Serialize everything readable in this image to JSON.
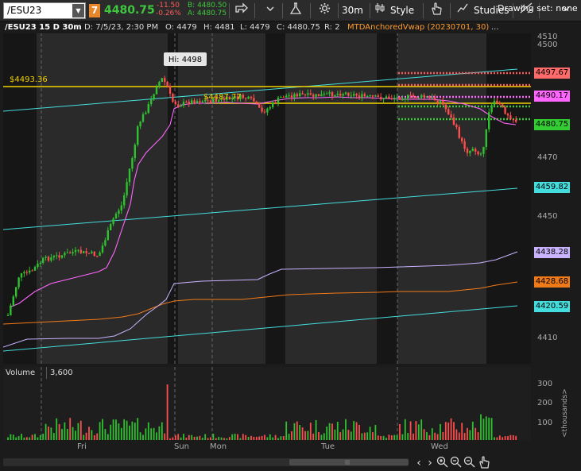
{
  "toolbar": {
    "symbol": "/ESU23",
    "badge": "7",
    "last_price": "4480.75",
    "change": "-11.50",
    "change_pct": "-0.26%",
    "bid": "B: 4480.50",
    "ask": "A: 4480.75",
    "timeframe": "30m",
    "style_label": "Style",
    "studies_label": "Studies"
  },
  "header": {
    "symbol_tf": "/ESU23 15 D 30m",
    "date": "D: 7/5/23, 2:30 PM",
    "open": "O: 4479",
    "high": "H: 4481",
    "low": "L: 4479",
    "close": "C: 4480.75",
    "range": "R: 2",
    "study": "MTDAnchoredVwap (20230701, 30)",
    "more": "..."
  },
  "annotations": {
    "hi_label": "Hi: 4498",
    "level_left": "$4493.36",
    "level_mid": "$4487.77"
  },
  "price_axis": {
    "ticks": [
      "4510",
      "4500",
      "4470",
      "4450",
      "4410"
    ],
    "tags": [
      {
        "label": "4497.67",
        "color": "#ff6a6a"
      },
      {
        "label": "4490.17",
        "color": "#ff66ff"
      },
      {
        "label": "4480.75",
        "color": "#33cc33"
      },
      {
        "label": "4459.82",
        "color": "#44dddd"
      },
      {
        "label": "4438.28",
        "color": "#c9b3ff"
      },
      {
        "label": "4428.68",
        "color": "#f07a18"
      },
      {
        "label": "4420.59",
        "color": "#44dddd"
      }
    ]
  },
  "volume": {
    "label": "Volume",
    "value": "3,600",
    "ticks": [
      "300",
      "200",
      "100"
    ],
    "unit": "<thousands>"
  },
  "time_axis": {
    "labels": [
      "Fri",
      "Sun",
      "Mon",
      "Tue",
      "Wed"
    ]
  },
  "bottom": {
    "drawing_set": "Drawing set: none"
  },
  "colors": {
    "up": "#2ec22e",
    "down": "#ff4d4d",
    "vwap": "#ff66ff",
    "cyan": "#44dddd",
    "orange": "#f07a18",
    "lavender": "#c9b3ff",
    "yellow": "#f2d100"
  },
  "icons": [
    "share-icon",
    "flask-icon",
    "gear-icon",
    "crosshair-icon",
    "hand-icon",
    "drawings-icon",
    "chevron-down-icon",
    "zoom-in-icon",
    "zoom-out-icon",
    "pan-icon"
  ]
}
